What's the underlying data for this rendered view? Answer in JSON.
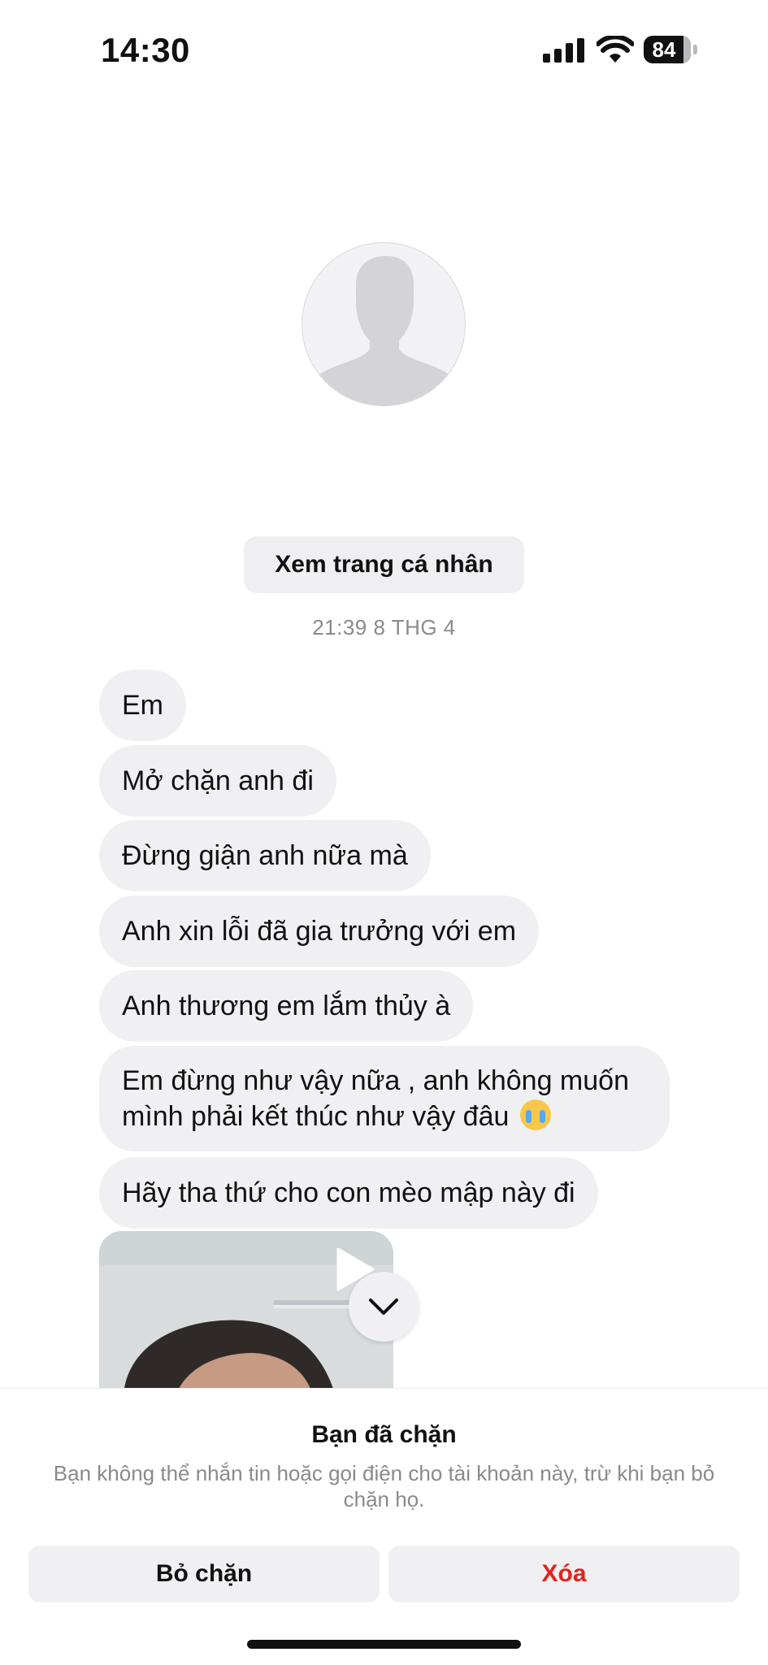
{
  "status_bar": {
    "time": "14:30",
    "battery": "84",
    "icons": [
      "signal-icon",
      "wifi-icon",
      "battery-icon"
    ]
  },
  "profile": {
    "avatar_icon": "default-avatar-icon",
    "view_profile_label": "Xem trang cá nhân"
  },
  "conversation": {
    "timestamp": "21:39 8 THG 4",
    "messages": [
      "Em",
      "Mở chặn anh đi",
      "Đừng giận anh nữa mà",
      "Anh xin lỗi đã gia trưởng với em",
      "Anh thương em lắm thủy à",
      "Em đừng như vậy nữa , anh không muốn mình phải kết thúc như vậy đâu",
      "Hãy tha thứ cho con mèo mập này đi"
    ],
    "message_6_emoji": "loudly-crying-face-emoji",
    "video_icon": "play-icon",
    "scroll_icon": "chevron-down-icon"
  },
  "blocked": {
    "title": "Bạn đã chặn",
    "description": "Bạn không thể nhắn tin hoặc gọi điện cho tài khoản này, trừ khi bạn bỏ chặn họ.",
    "unblock_label": "Bỏ chặn",
    "delete_label": "Xóa"
  },
  "colors": {
    "bubble": "#f0f0f2",
    "delete": "#e0241f",
    "muted_text": "#8a8a8e"
  }
}
